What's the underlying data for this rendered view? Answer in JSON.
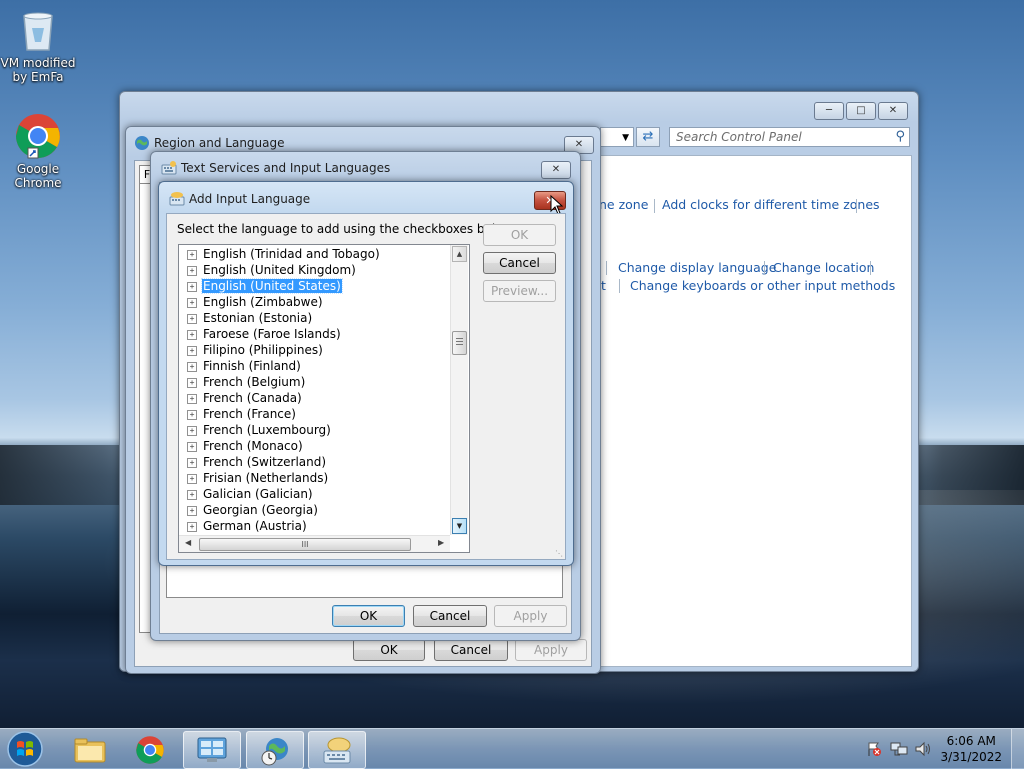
{
  "desktop": {
    "icons": [
      {
        "label_line1": "VM modified",
        "label_line2": "by EmFa",
        "icon": "recycle-bin-icon"
      },
      {
        "label_line1": "Google",
        "label_line2": "Chrome",
        "icon": "chrome-icon"
      }
    ]
  },
  "control_panel": {
    "search_placeholder": "Search Control Panel",
    "links_row1": [
      "ne zone",
      "Add clocks for different time zones"
    ],
    "links_row2": [
      "Change display language",
      "Change location"
    ],
    "links_row3": [
      "t",
      "Change keyboards or other input methods"
    ]
  },
  "region_language": {
    "title": "Region and Language",
    "tab_fragment": "F",
    "buttons": {
      "ok": "OK",
      "cancel": "Cancel",
      "apply": "Apply"
    }
  },
  "text_services": {
    "title": "Text Services and Input Languages",
    "buttons": {
      "ok": "OK",
      "cancel": "Cancel",
      "apply": "Apply"
    }
  },
  "add_input_language": {
    "title": "Add Input Language",
    "instruction": "Select the language to add using the checkboxes below.",
    "buttons": {
      "ok": "OK",
      "cancel": "Cancel",
      "preview": "Preview..."
    },
    "languages": [
      "English (Trinidad and Tobago)",
      "English (United Kingdom)",
      "English (United States)",
      "English (Zimbabwe)",
      "Estonian (Estonia)",
      "Faroese (Faroe Islands)",
      "Filipino (Philippines)",
      "Finnish (Finland)",
      "French (Belgium)",
      "French (Canada)",
      "French (France)",
      "French (Luxembourg)",
      "French (Monaco)",
      "French (Switzerland)",
      "Frisian (Netherlands)",
      "Galician (Galician)",
      "Georgian (Georgia)",
      "German (Austria)"
    ],
    "selected_language": "English (United States)",
    "hscroll_grip": "III"
  },
  "taskbar": {
    "time": "6:06 AM",
    "date": "3/31/2022",
    "items": [
      "start-orb",
      "windows-explorer",
      "google-chrome",
      "control-panel",
      "region-language",
      "text-services"
    ]
  },
  "colors": {
    "link": "#1f5aa8",
    "selection": "#3399ff",
    "close_button": "#c4513f"
  }
}
